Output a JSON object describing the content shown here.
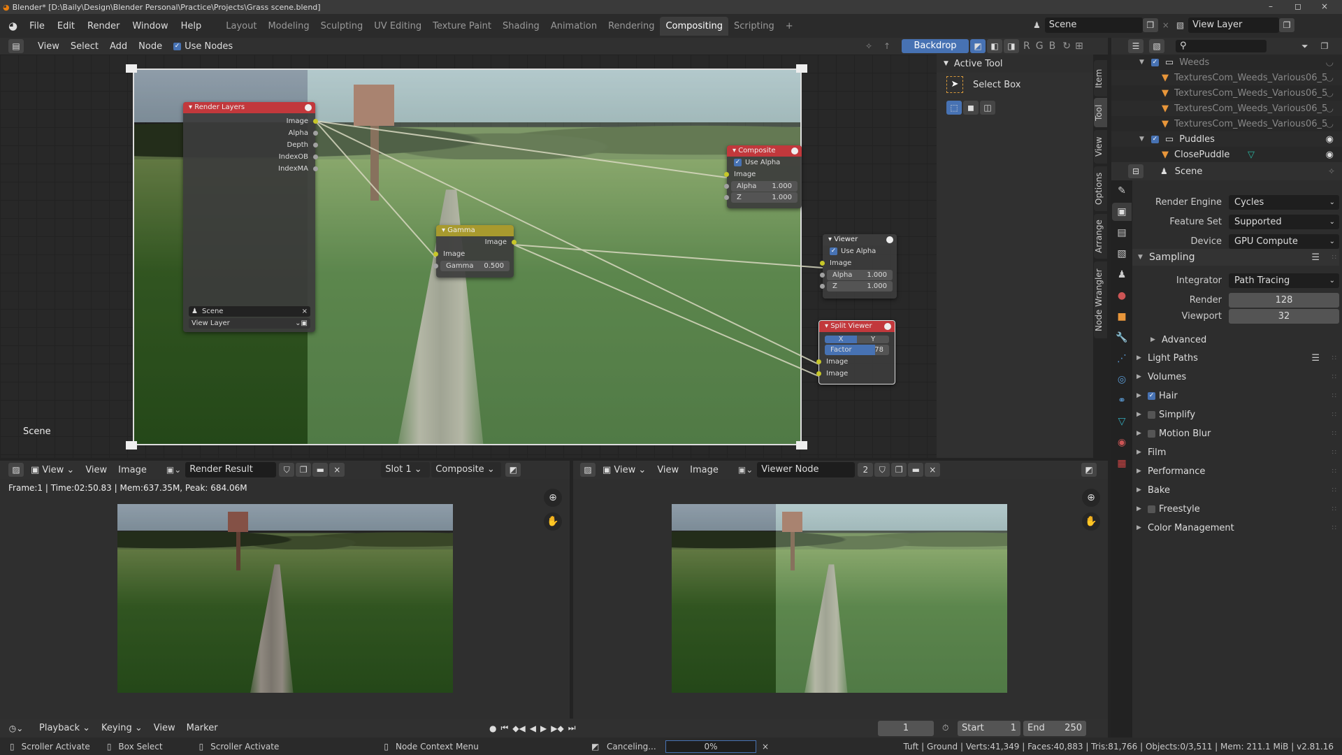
{
  "titlebar": {
    "title": "Blender* [D:\\Baily\\Design\\Blender Personal\\Practice\\Projects\\Grass scene.blend]",
    "minimize": "–",
    "maximize": "◻",
    "close": "×"
  },
  "topbar": {
    "menus": [
      "File",
      "Edit",
      "Render",
      "Window",
      "Help"
    ],
    "workspaces": [
      "Layout",
      "Modeling",
      "Sculpting",
      "UV Editing",
      "Texture Paint",
      "Shading",
      "Animation",
      "Rendering",
      "Compositing",
      "Scripting",
      "+"
    ],
    "active_workspace": "Compositing",
    "scene": "Scene",
    "view_layer": "View Layer"
  },
  "node_header": {
    "menus": [
      "View",
      "Select",
      "Add",
      "Node"
    ],
    "use_nodes_label": "Use Nodes",
    "use_nodes": true,
    "backdrop_label": "Backdrop",
    "channels": [
      "R",
      "G",
      "B"
    ]
  },
  "node_editor": {
    "scene_label": "Scene",
    "nodes": {
      "render_layers": {
        "title": "Render Layers",
        "color": "#c2383c",
        "outputs": [
          "Image",
          "Alpha",
          "Depth",
          "IndexOB",
          "IndexMA"
        ],
        "scene": "Scene",
        "view_layer": "View Layer"
      },
      "composite": {
        "title": "Composite",
        "color": "#c2383c",
        "use_alpha_label": "Use Alpha",
        "input": "Image",
        "alpha_label": "Alpha",
        "alpha": "1.000",
        "z_label": "Z",
        "z": "1.000"
      },
      "gamma": {
        "title": "Gamma",
        "color": "#a89a2e",
        "output": "Image",
        "input": "Image",
        "gamma_label": "Gamma",
        "gamma": "0.500"
      },
      "viewer": {
        "title": "Viewer",
        "color": "#3c3c3c",
        "use_alpha_label": "Use Alpha",
        "input": "Image",
        "alpha_label": "Alpha",
        "alpha": "1.000",
        "z_label": "Z",
        "z": "1.000"
      },
      "split_viewer": {
        "title": "Split Viewer",
        "color": "#c2383c",
        "axis_x": "X",
        "axis_y": "Y",
        "factor_label": "Factor",
        "factor": "78",
        "inputs": [
          "Image",
          "Image"
        ]
      }
    }
  },
  "npanel": {
    "section": "Active Tool",
    "tool": "Select Box",
    "tabs": [
      "Item",
      "Tool",
      "View",
      "Options",
      "Arrange",
      "Node Wrangler"
    ],
    "active_tab": "Tool"
  },
  "outliner": {
    "items": [
      {
        "name": "Weeds",
        "type": "collection"
      },
      {
        "name": "TexturesCom_Weeds_Various06_5",
        "type": "mesh"
      },
      {
        "name": "TexturesCom_Weeds_Various06_5",
        "type": "mesh"
      },
      {
        "name": "TexturesCom_Weeds_Various06_5",
        "type": "mesh"
      },
      {
        "name": "TexturesCom_Weeds_Various06_5",
        "type": "mesh"
      },
      {
        "name": "Puddles",
        "type": "collection"
      },
      {
        "name": "ClosePuddle",
        "type": "mesh"
      }
    ]
  },
  "properties": {
    "context": "Scene",
    "render_engine_label": "Render Engine",
    "render_engine": "Cycles",
    "feature_set_label": "Feature Set",
    "feature_set": "Supported",
    "device_label": "Device",
    "device": "GPU Compute",
    "sampling": "Sampling",
    "integrator_label": "Integrator",
    "integrator": "Path Tracing",
    "render_label": "Render",
    "render_samples": "128",
    "viewport_label": "Viewport",
    "viewport_samples": "32",
    "advanced": "Advanced",
    "sections": [
      {
        "label": "Light Paths",
        "checkbox": null
      },
      {
        "label": "Volumes",
        "checkbox": null
      },
      {
        "label": "Hair",
        "checkbox": true
      },
      {
        "label": "Simplify",
        "checkbox": false
      },
      {
        "label": "Motion Blur",
        "checkbox": false
      },
      {
        "label": "Film",
        "checkbox": null
      },
      {
        "label": "Performance",
        "checkbox": null
      },
      {
        "label": "Bake",
        "checkbox": null
      },
      {
        "label": "Freestyle",
        "checkbox": false
      },
      {
        "label": "Color Management",
        "checkbox": null
      }
    ]
  },
  "image_left": {
    "menus": [
      "View",
      "View",
      "Image"
    ],
    "image": "Render Result",
    "slot": "Slot 1",
    "layer": "Composite",
    "info": "Frame:1 | Time:02:50.83 | Mem:637.35M, Peak: 684.06M"
  },
  "image_right": {
    "menus": [
      "View",
      "View",
      "Image"
    ],
    "image": "Viewer Node",
    "users": "2"
  },
  "timeline": {
    "menus": [
      "Playback",
      "Keying",
      "View",
      "Marker"
    ],
    "current_frame": "1",
    "start_label": "Start",
    "start": "1",
    "end_label": "End",
    "end": "250"
  },
  "statusbar": {
    "left": [
      "Scroller Activate",
      "Box Select",
      "Scroller Activate",
      "Node Context Menu"
    ],
    "progress_label": "Canceling...",
    "progress": "0%",
    "progress_value": 0,
    "stats": "Tuft | Ground | Verts:41,349 | Faces:40,883 | Tris:81,766 | Objects:0/3,511 | Mem: 211.1 MiB | v2.81.16"
  }
}
